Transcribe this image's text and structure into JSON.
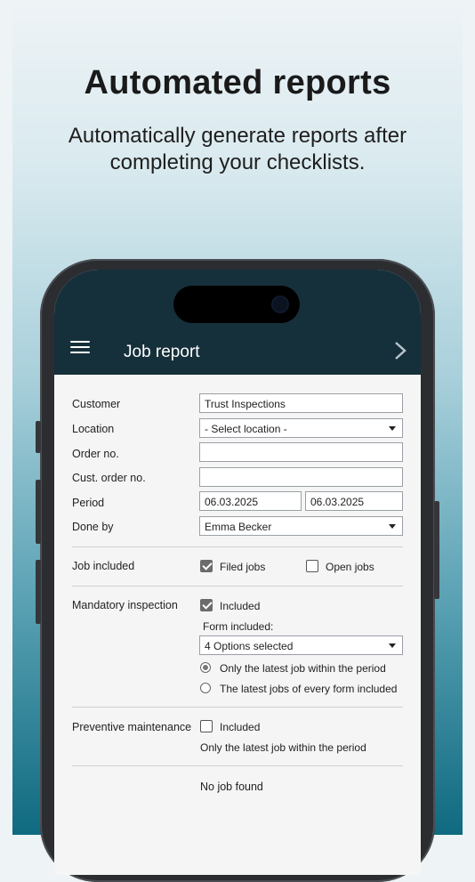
{
  "headline": "Automated reports",
  "subline": "Automatically generate reports after completing your checklists.",
  "app": {
    "title": "Job report",
    "menu_icon": "hamburger-menu-icon",
    "next_icon": "chevron-right-icon"
  },
  "form": {
    "customer": {
      "label": "Customer",
      "value": "Trust Inspections"
    },
    "location": {
      "label": "Location",
      "value": "- Select location -"
    },
    "order_no": {
      "label": "Order no.",
      "value": ""
    },
    "cust_order_no": {
      "label": "Cust. order no.",
      "value": ""
    },
    "period": {
      "label": "Period",
      "from": "06.03.2025",
      "to": "06.03.2025"
    },
    "done_by": {
      "label": "Done by",
      "value": "Emma Becker"
    },
    "job_included": {
      "label": "Job included",
      "filed": {
        "label": "Filed jobs",
        "checked": true
      },
      "open": {
        "label": "Open jobs",
        "checked": false
      }
    },
    "mandatory": {
      "label": "Mandatory inspection",
      "included": {
        "label": "Included",
        "checked": true
      },
      "form_included_label": "Form included:",
      "form_included_value": "4 Options selected",
      "option_latest": {
        "label": "Only the latest job within the period",
        "selected": true
      },
      "option_every": {
        "label": "The latest jobs of every form included",
        "selected": false
      }
    },
    "preventive": {
      "label": "Preventive maintenance",
      "included": {
        "label": "Included",
        "checked": false
      },
      "note": "Only the latest job within the period"
    },
    "result": "No job found"
  },
  "colors": {
    "topbar": "#16303b",
    "form_bg": "#f5f5f5"
  }
}
